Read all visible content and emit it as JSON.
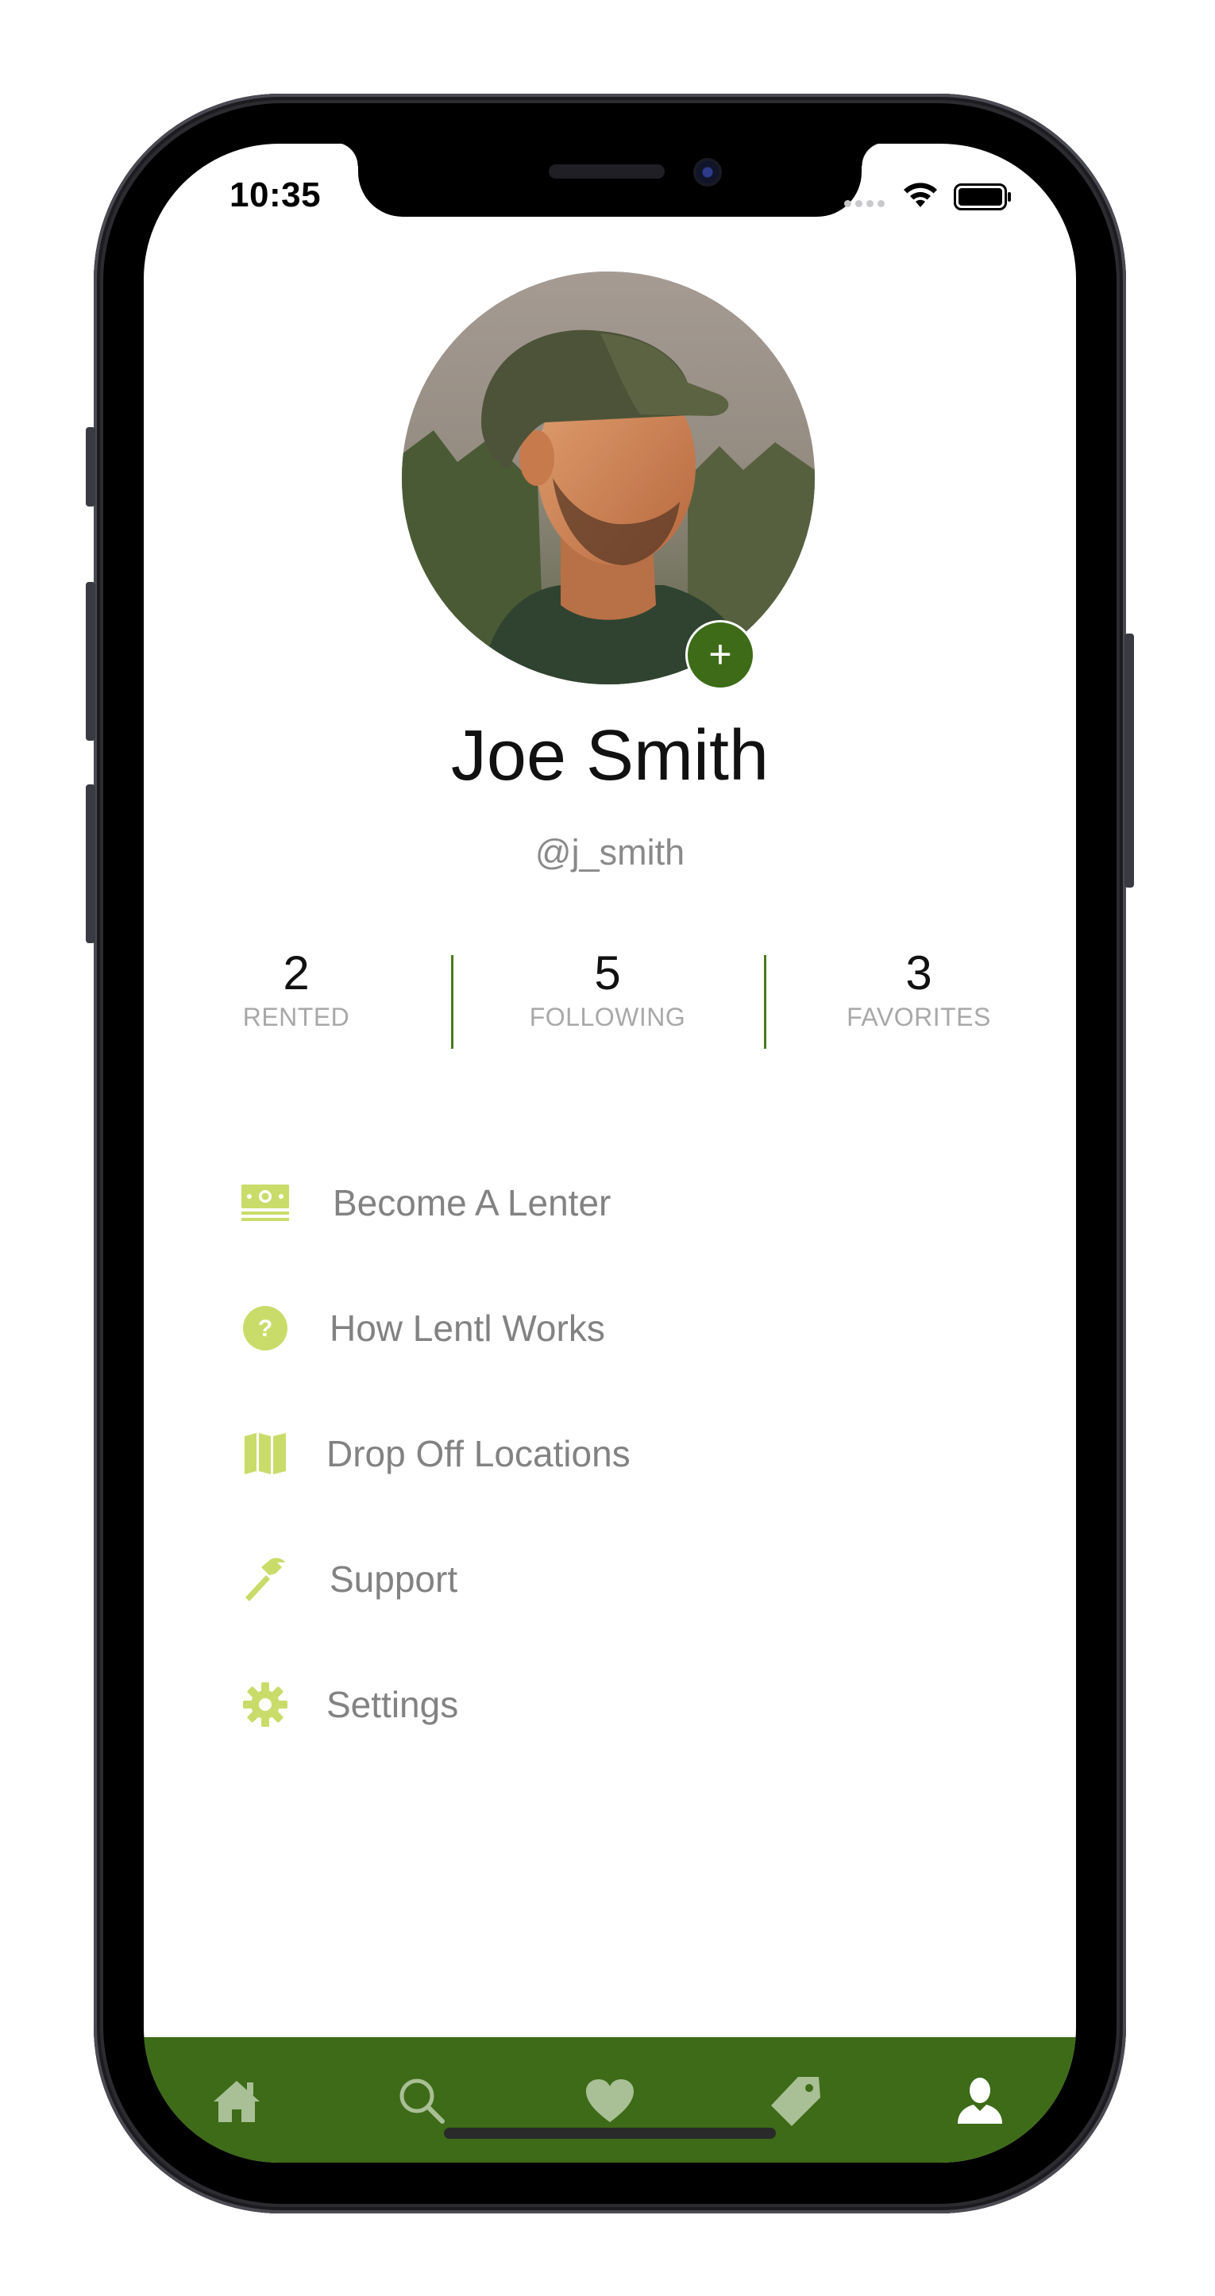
{
  "status_bar": {
    "time": "10:35"
  },
  "profile": {
    "name": "Joe Smith",
    "handle": "@j_smith",
    "add_photo_label": "+",
    "avatar_icon": "profile-photo"
  },
  "stats": [
    {
      "value": "2",
      "label": "RENTED"
    },
    {
      "value": "5",
      "label": "FOLLOWING"
    },
    {
      "value": "3",
      "label": "FAVORITES"
    }
  ],
  "menu": [
    {
      "label": "Become A Lenter",
      "icon": "money-icon"
    },
    {
      "label": "How Lentl Works",
      "icon": "question-circle-icon"
    },
    {
      "label": "Drop Off Locations",
      "icon": "map-icon"
    },
    {
      "label": "Support",
      "icon": "hammer-icon"
    },
    {
      "label": "Settings",
      "icon": "gear-icon"
    }
  ],
  "tab_bar": [
    {
      "icon": "home-icon",
      "active": false
    },
    {
      "icon": "search-icon",
      "active": false
    },
    {
      "icon": "heart-icon",
      "active": false
    },
    {
      "icon": "tag-icon",
      "active": false
    },
    {
      "icon": "user-icon",
      "active": true
    }
  ],
  "colors": {
    "brand_green": "#3d6b17",
    "icon_lime": "#c9dc6a",
    "tab_inactive": "#a9bf95",
    "tab_active": "#ffffff",
    "menu_text": "#828282"
  }
}
